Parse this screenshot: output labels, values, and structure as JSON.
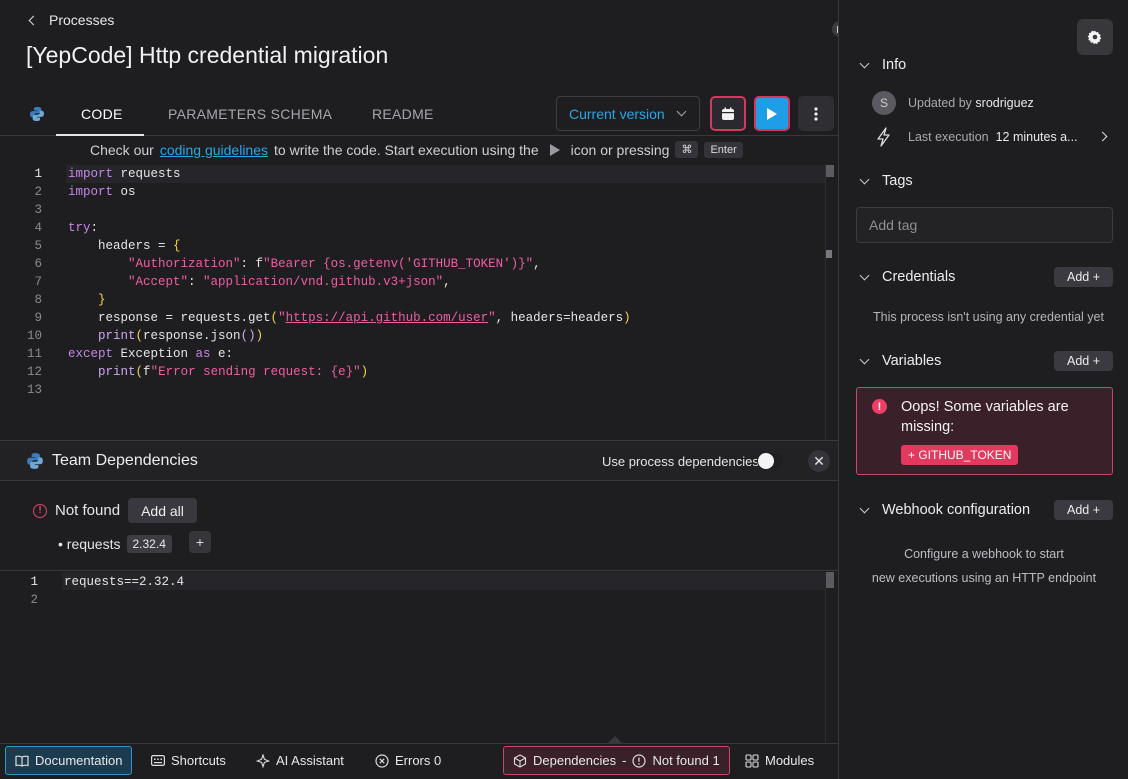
{
  "breadcrumb": {
    "label": "Processes"
  },
  "page_title": "[YepCode] Http credential migration",
  "tabs": [
    {
      "label": "CODE",
      "active": true
    },
    {
      "label": "PARAMETERS SCHEMA",
      "active": false
    },
    {
      "label": "README",
      "active": false
    }
  ],
  "version_select": {
    "value": "Current version"
  },
  "hint": {
    "prefix": "Check our",
    "link": "coding guidelines",
    "middle": "to write the code. Start execution using the",
    "suffix": "icon or pressing",
    "key1": "⌘",
    "key2": "Enter"
  },
  "editor": {
    "line_numbers": [
      "1",
      "2",
      "3",
      "4",
      "5",
      "6",
      "7",
      "8",
      "9",
      "10",
      "11",
      "12",
      "13"
    ],
    "active_line": "1"
  },
  "team_deps": {
    "title": "Team Dependencies",
    "use_process_label": "Use process dependencies",
    "use_process_enabled": false,
    "not_found_label": "Not found",
    "add_all_label": "Add all",
    "dep_name": "• requests",
    "dep_version": "2.32.4",
    "req_lines": [
      "1",
      "2"
    ],
    "req_text": "requests==2.32.4"
  },
  "bottom_bar": {
    "documentation": "Documentation",
    "shortcuts": "Shortcuts",
    "ai": "AI Assistant",
    "errors": "Errors 0",
    "dependencies": "Dependencies",
    "dep_sep": "-",
    "not_found": "Not found 1",
    "modules": "Modules"
  },
  "right_panel": {
    "info_title": "Info",
    "avatar_letter": "S",
    "updated_by_label": "Updated by",
    "updated_by_user": "srodriguez",
    "last_exec_label": "Last execution",
    "last_exec_value": "12 minutes a...",
    "tags_title": "Tags",
    "tag_placeholder": "Add tag",
    "credentials_title": "Credentials",
    "add_label": "Add +",
    "no_credentials": "This process isn't using any credential yet",
    "variables_title": "Variables",
    "alert_message": "Oops! Some variables are missing:",
    "missing_var": "+ GITHUB_TOKEN",
    "webhook_title": "Webhook configuration",
    "webhook_text_1": "Configure a webhook to start",
    "webhook_text_2": "new executions using an HTTP endpoint"
  },
  "colors": {
    "accent": "#1f9ee8",
    "danger": "#e13a5e",
    "link": "#27a9e6"
  }
}
